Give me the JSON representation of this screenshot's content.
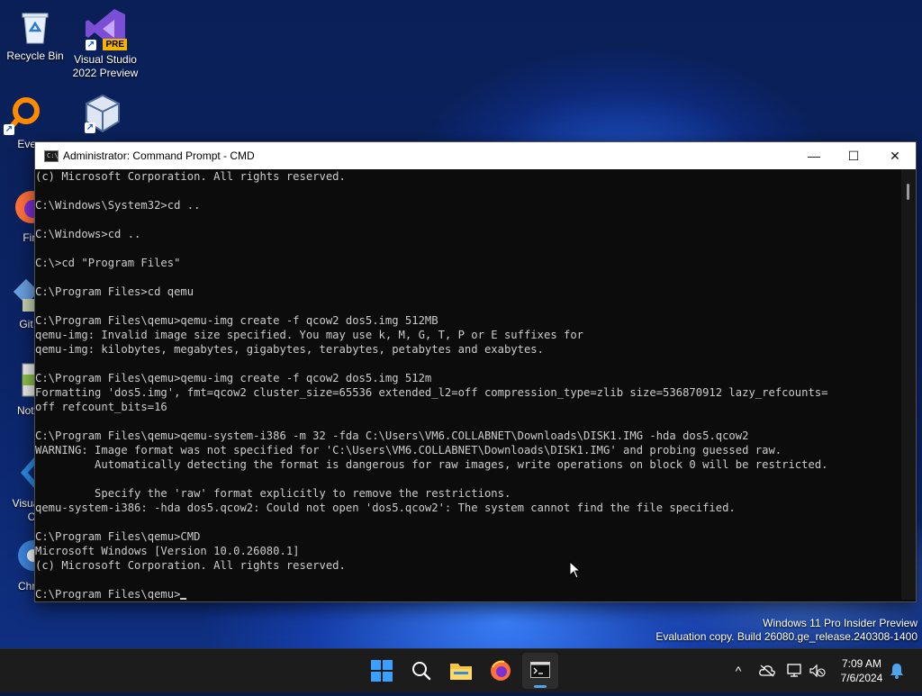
{
  "desktop": {
    "icons": [
      {
        "label": "Recycle Bin"
      },
      {
        "label": "Visual Studio\n2022 Preview",
        "badge": "PRE"
      },
      {
        "label": "Every"
      },
      {
        "label": ""
      },
      {
        "label": "Fire"
      },
      {
        "label": "Git B"
      },
      {
        "label": "Notep"
      },
      {
        "label": "Visual\nCo"
      },
      {
        "label": "Chro"
      }
    ],
    "watermark_line1": "Windows 11 Pro Insider Preview",
    "watermark_line2": "Evaluation copy. Build 26080.ge_release.240308-1400"
  },
  "window": {
    "title": "Administrator: Command Prompt - CMD",
    "minimize": "—",
    "maximize": "☐",
    "close": "✕"
  },
  "console": {
    "lines": [
      "(c) Microsoft Corporation. All rights reserved.",
      "",
      "C:\\Windows\\System32>cd ..",
      "",
      "C:\\Windows>cd ..",
      "",
      "C:\\>cd \"Program Files\"",
      "",
      "C:\\Program Files>cd qemu",
      "",
      "C:\\Program Files\\qemu>qemu-img create -f qcow2 dos5.img 512MB",
      "qemu-img: Invalid image size specified. You may use k, M, G, T, P or E suffixes for",
      "qemu-img: kilobytes, megabytes, gigabytes, terabytes, petabytes and exabytes.",
      "",
      "C:\\Program Files\\qemu>qemu-img create -f qcow2 dos5.img 512m",
      "Formatting 'dos5.img', fmt=qcow2 cluster_size=65536 extended_l2=off compression_type=zlib size=536870912 lazy_refcounts=",
      "off refcount_bits=16",
      "",
      "C:\\Program Files\\qemu>qemu-system-i386 -m 32 -fda C:\\Users\\VM6.COLLABNET\\Downloads\\DISK1.IMG -hda dos5.qcow2",
      "WARNING: Image format was not specified for 'C:\\Users\\VM6.COLLABNET\\Downloads\\DISK1.IMG' and probing guessed raw.",
      "         Automatically detecting the format is dangerous for raw images, write operations on block 0 will be restricted.",
      "",
      "         Specify the 'raw' format explicitly to remove the restrictions.",
      "qemu-system-i386: -hda dos5.qcow2: Could not open 'dos5.qcow2': The system cannot find the file specified.",
      "",
      "C:\\Program Files\\qemu>CMD",
      "Microsoft Windows [Version 10.0.26080.1]",
      "(c) Microsoft Corporation. All rights reserved.",
      "",
      "C:\\Program Files\\qemu>"
    ]
  },
  "taskbar": {
    "apps": [
      {
        "name": "start"
      },
      {
        "name": "search"
      },
      {
        "name": "file-explorer"
      },
      {
        "name": "firefox"
      },
      {
        "name": "command-prompt",
        "active": true
      }
    ],
    "tray": {
      "chevron": "^",
      "time": "7:09 AM",
      "date": "7/6/2024"
    }
  },
  "colors": {
    "console_bg": "#0c0c0c",
    "console_fg": "#cccccc",
    "taskbar_bg": "#1c1c1c",
    "accent": "#4fa3e8"
  }
}
